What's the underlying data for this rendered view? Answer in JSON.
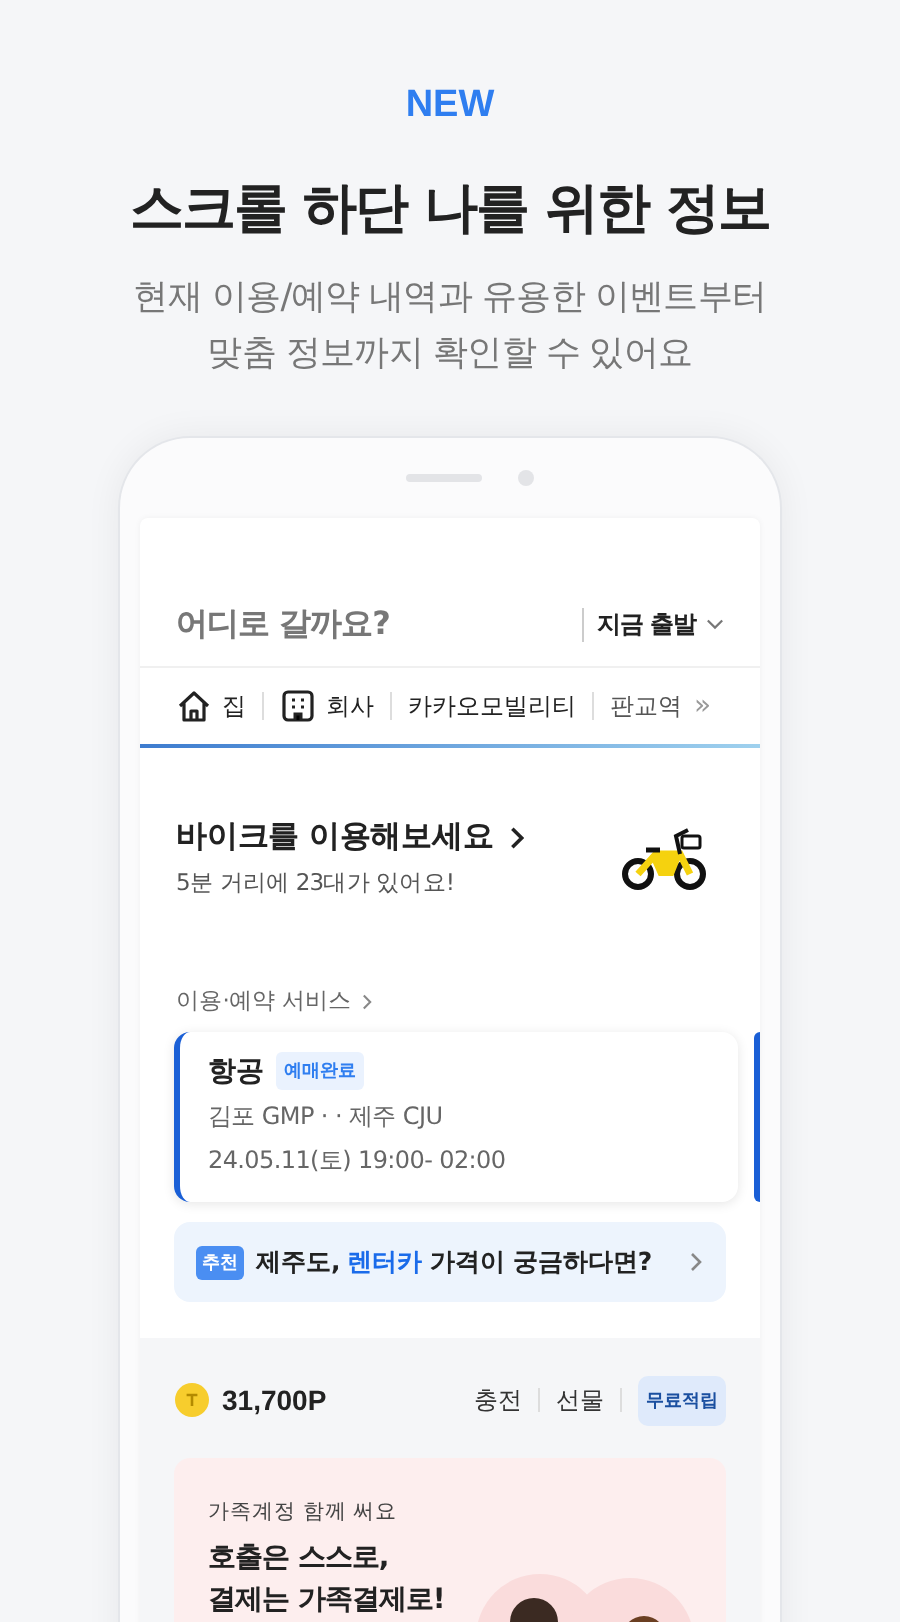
{
  "header": {
    "badge": "NEW",
    "title": "스크롤 하단 나를 위한 정보",
    "subtitle_lines": [
      "현재 이용/예약 내역과 유용한 이벤트부터",
      "맞춤 정보까지 확인할 수 있어요"
    ]
  },
  "search": {
    "placeholder": "어디로 갈까요?",
    "departure": "지금 출발"
  },
  "shortcuts": [
    {
      "kind": "home",
      "label": "집"
    },
    {
      "kind": "office",
      "label": "회사"
    },
    {
      "kind": "place",
      "label": "카카오모빌리티"
    },
    {
      "kind": "place",
      "label": "판교역"
    }
  ],
  "shortcuts_more": "»",
  "bike": {
    "title": "바이크를 이용해보세요",
    "subtitle": "5분 거리에 23대가 있어요!"
  },
  "services_link": "이용·예약 서비스",
  "reservation": {
    "category": "항공",
    "status": "예매완료",
    "route": "김포 GMP · · 제주 CJU",
    "datetime": "24.05.11(토) 19:00- 02:00"
  },
  "recommend": {
    "badge": "추천",
    "before": "제주도, ",
    "highlight": "렌터카",
    "after": " 가격이 궁금하다면?"
  },
  "points": {
    "amount": "31,700P",
    "actions": [
      "충전",
      "선물"
    ],
    "promo": "무료적립"
  },
  "family_banner": {
    "caption": "가족계정 함께 써요",
    "headline_lines": [
      "호출은 스스로,",
      "결제는 가족결제로!"
    ]
  }
}
